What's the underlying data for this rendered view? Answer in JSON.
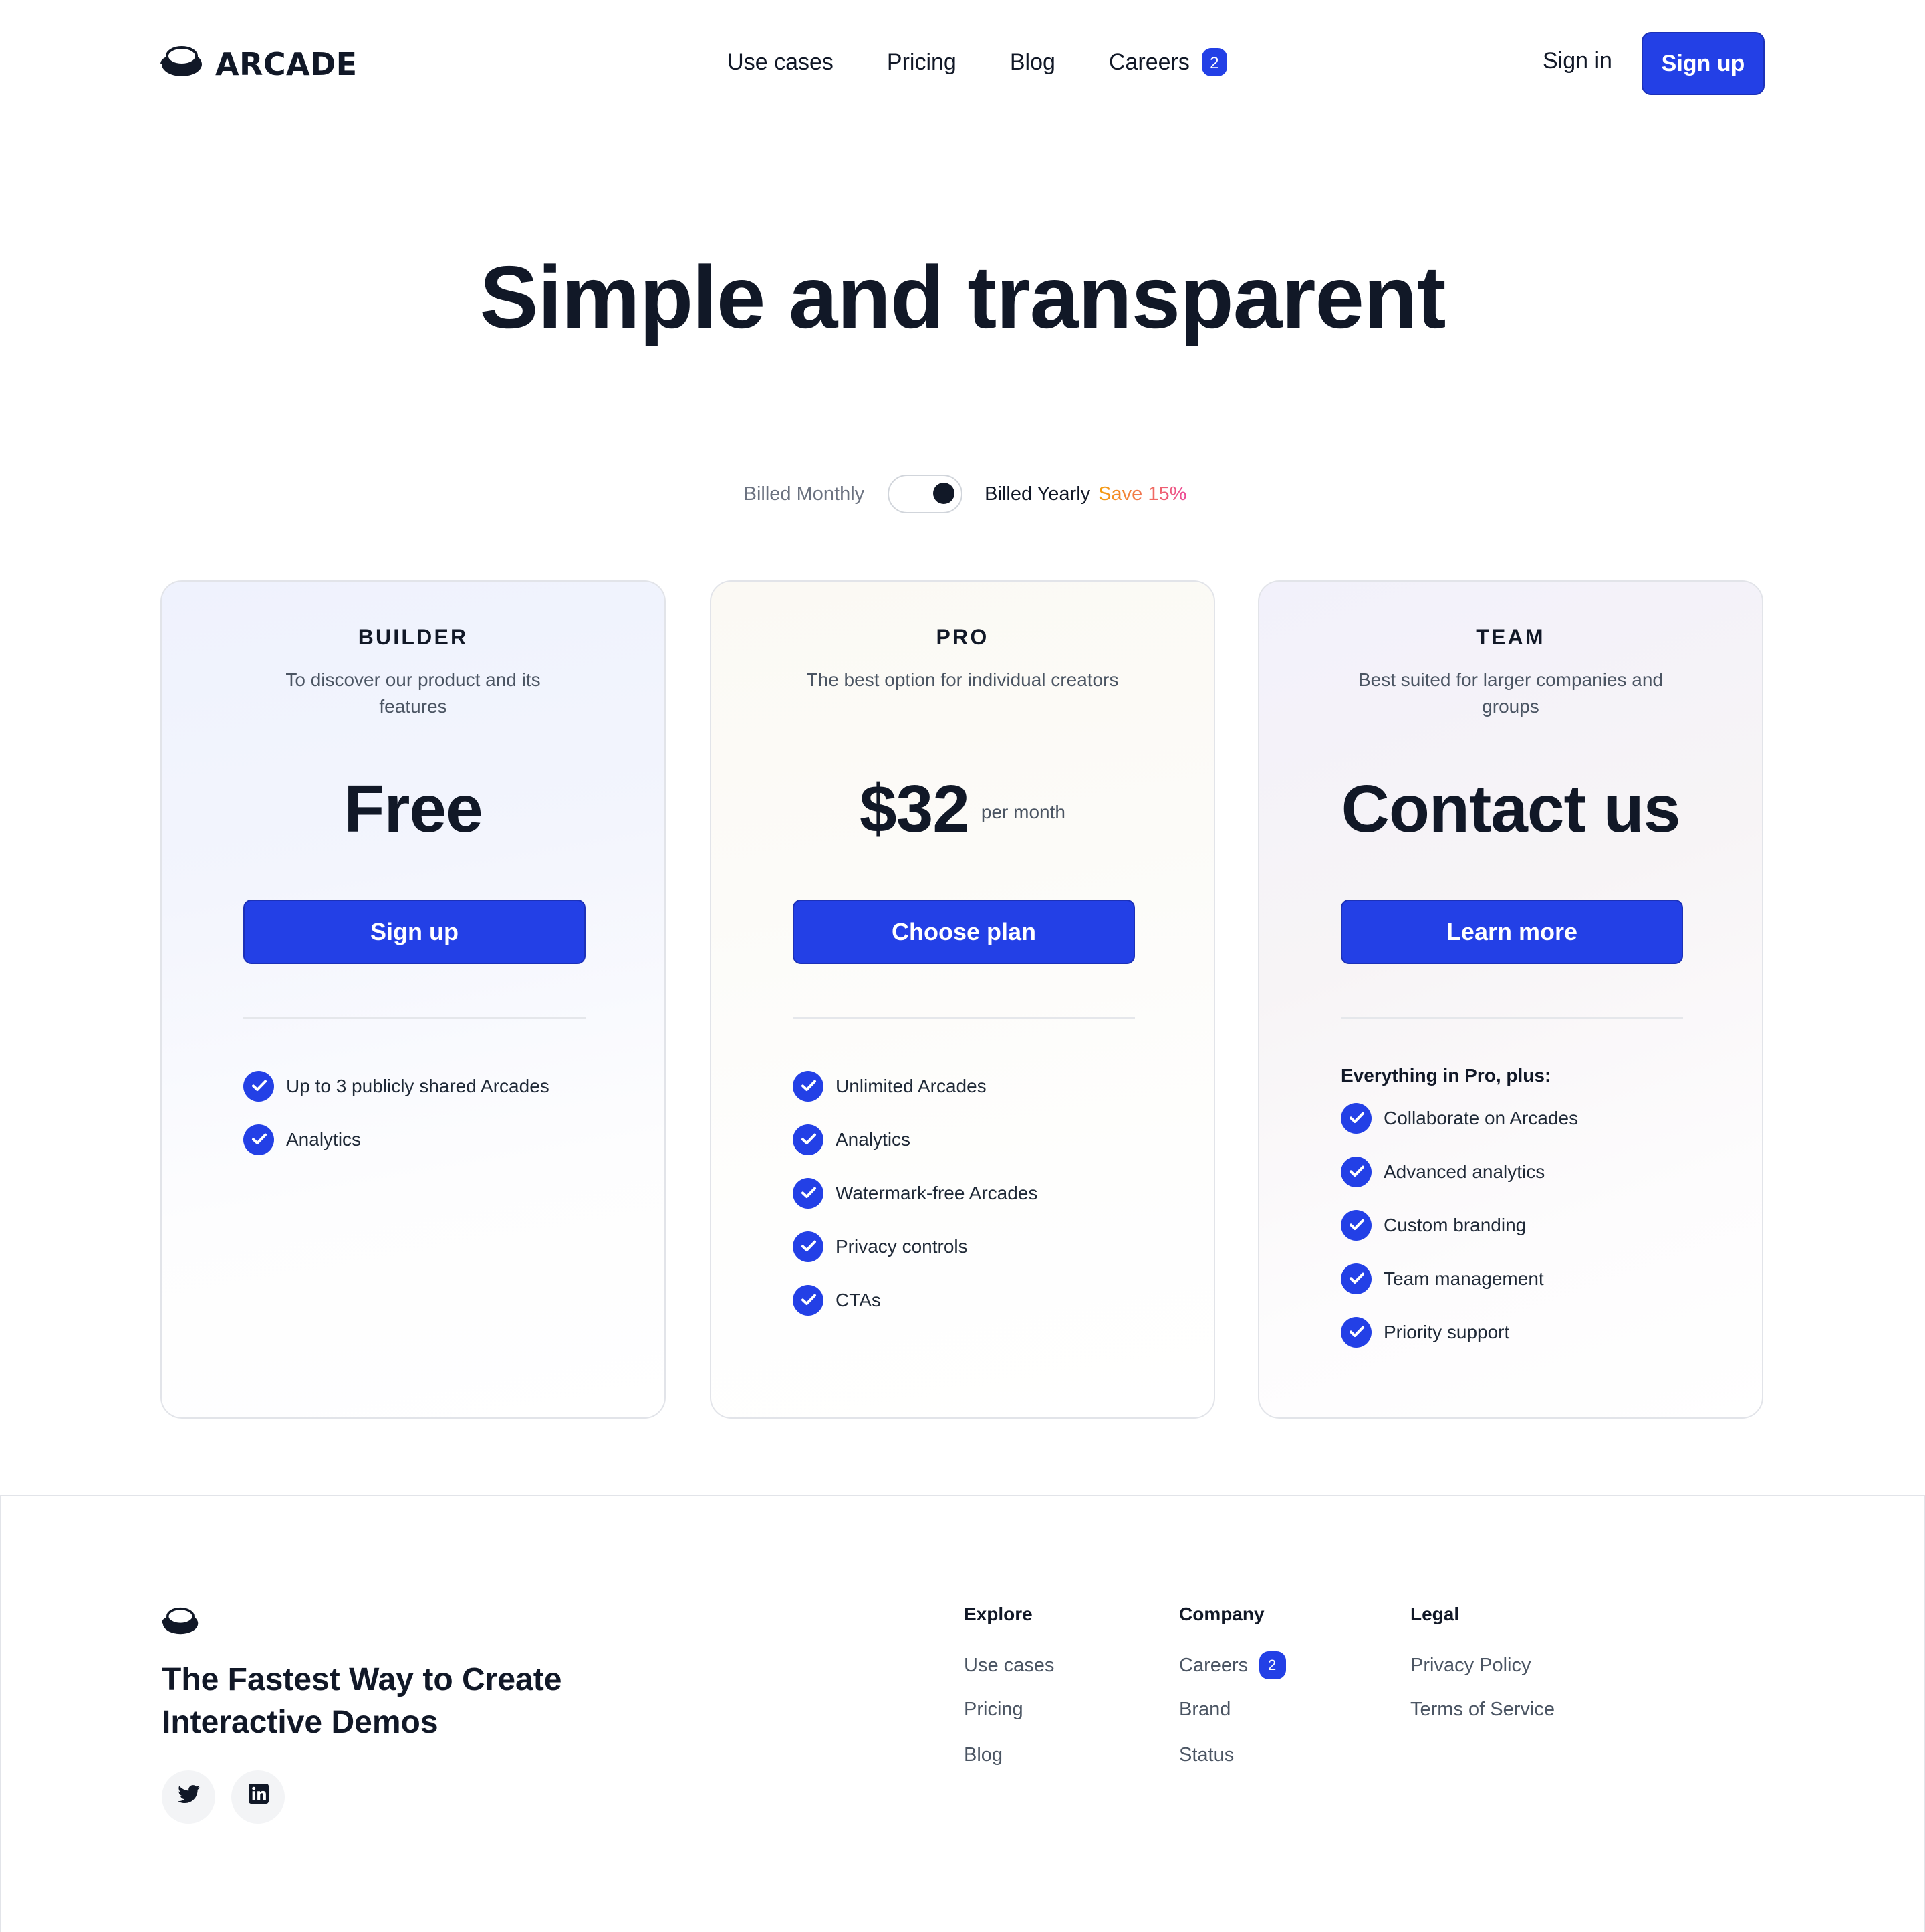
{
  "header": {
    "brand": "ARCADE",
    "nav": [
      {
        "label": "Use cases"
      },
      {
        "label": "Pricing"
      },
      {
        "label": "Blog"
      },
      {
        "label": "Careers",
        "badge": "2"
      }
    ],
    "sign_in": "Sign in",
    "sign_up": "Sign up"
  },
  "hero": {
    "title": "Simple and transparent"
  },
  "billing": {
    "monthly_label": "Billed Monthly",
    "yearly_label": "Billed Yearly",
    "save_label": "Save 15%",
    "selected": "yearly"
  },
  "plans": [
    {
      "name": "BUILDER",
      "description": "To discover our product and its features",
      "price": "Free",
      "price_unit": "",
      "cta": "Sign up",
      "features_heading": "",
      "features": [
        "Up to 3 publicly shared Arcades",
        "Analytics"
      ]
    },
    {
      "name": "PRO",
      "description": "The best option for individual creators",
      "price": "$32",
      "price_unit": "per month",
      "cta": "Choose plan",
      "features_heading": "",
      "features": [
        "Unlimited Arcades",
        "Analytics",
        "Watermark-free Arcades",
        "Privacy controls",
        "CTAs"
      ]
    },
    {
      "name": "TEAM",
      "description": "Best suited for larger companies and groups",
      "price": "Contact us",
      "price_unit": "",
      "cta": "Learn more",
      "features_heading": "Everything in Pro, plus:",
      "features": [
        "Collaborate on Arcades",
        "Advanced analytics",
        "Custom branding",
        "Team management",
        "Priority support"
      ]
    }
  ],
  "footer": {
    "tagline": "The Fastest Way to Create Interactive Demos",
    "socials": [
      {
        "icon": "twitter-icon",
        "label": "Twitter"
      },
      {
        "icon": "linkedin-icon",
        "label": "LinkedIn"
      }
    ],
    "columns": [
      {
        "title": "Explore",
        "links": [
          {
            "label": "Use cases"
          },
          {
            "label": "Pricing"
          },
          {
            "label": "Blog"
          }
        ]
      },
      {
        "title": "Company",
        "links": [
          {
            "label": "Careers",
            "badge": "2"
          },
          {
            "label": "Brand"
          },
          {
            "label": "Status"
          }
        ]
      },
      {
        "title": "Legal",
        "links": [
          {
            "label": "Privacy Policy"
          },
          {
            "label": "Terms of Service"
          }
        ]
      }
    ]
  },
  "colors": {
    "accent": "#2340e6",
    "text": "#111827",
    "muted": "#4b5563",
    "save_gradient_start": "#f59e0b",
    "save_gradient_end": "#ec4899"
  }
}
